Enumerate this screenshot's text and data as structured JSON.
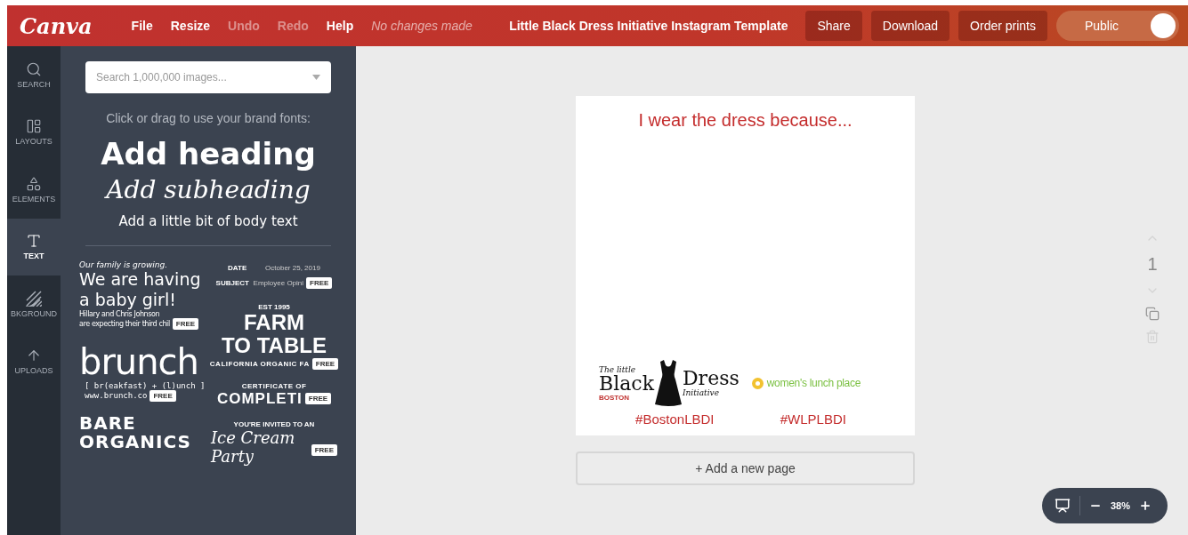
{
  "topbar": {
    "logo": "Canva",
    "menu": [
      {
        "label": "File",
        "disabled": false
      },
      {
        "label": "Resize",
        "disabled": false
      },
      {
        "label": "Undo",
        "disabled": true
      },
      {
        "label": "Redo",
        "disabled": true
      },
      {
        "label": "Help",
        "disabled": false
      }
    ],
    "status": "No changes made",
    "title": "Little Black Dress Initiative Instagram Template",
    "buttons": [
      "Share",
      "Download",
      "Order prints"
    ],
    "visibility": {
      "label": "Public",
      "on": true
    }
  },
  "rail": [
    {
      "label": "SEARCH",
      "selected": false
    },
    {
      "label": "LAYOUTS",
      "selected": false
    },
    {
      "label": "ELEMENTS",
      "selected": false
    },
    {
      "label": "TEXT",
      "selected": true
    },
    {
      "label": "BKGROUND",
      "selected": false
    },
    {
      "label": "UPLOADS",
      "selected": false
    }
  ],
  "panel": {
    "search": {
      "placeholder": "Search 1,000,000 images..."
    },
    "hint": "Click or drag to use your brand fonts:",
    "add_heading": "Add heading",
    "add_subheading": "Add subheading",
    "add_body": "Add a little bit of body text",
    "templates": [
      [
        {
          "badge": "FREE",
          "lines": [
            {
              "kind": "hand-small",
              "text": "Our family is growing."
            },
            {
              "kind": "hand-large",
              "text": "We are having"
            },
            {
              "kind": "hand-large",
              "text": "a baby girl!"
            },
            {
              "kind": "hand-tiny",
              "text": "Hillary and Chris Johnson"
            },
            {
              "kind": "hand-tiny",
              "text": "are expecting their third chil"
            }
          ]
        },
        {
          "badge": "FREE",
          "lines": [
            {
              "kind": "huge",
              "text": "brunch"
            },
            {
              "kind": "mono",
              "text": "[ br(eakfast) + (l)unch ]"
            },
            {
              "kind": "mono",
              "text": "www.brunch.co"
            }
          ]
        },
        {
          "lines": [
            {
              "kind": "wide",
              "text": "BARE"
            },
            {
              "kind": "wide",
              "text": "ORGANICS"
            }
          ]
        }
      ],
      [
        {
          "badge": "FREE",
          "lines": [
            {
              "kind": "pair",
              "label": "DATE",
              "value": "October 25, 2019"
            },
            {
              "kind": "pair",
              "label": "SUBJECT",
              "value": "Employee Opini"
            }
          ]
        },
        {
          "badge": "FREE",
          "lines": [
            {
              "kind": "tiny-caps",
              "text": "EST 1995"
            },
            {
              "kind": "bold-big",
              "text": "FARM"
            },
            {
              "kind": "bold-big",
              "text": "TO TABLE"
            },
            {
              "kind": "small-caps",
              "text": "CALIFORNIA ORGANIC FA"
            }
          ]
        },
        {
          "badge": "FREE",
          "lines": [
            {
              "kind": "small-caps",
              "text": "CERTIFICATE OF"
            },
            {
              "kind": "bold-mid",
              "text": "COMPLETI"
            }
          ]
        },
        {
          "badge": "FREE",
          "lines": [
            {
              "kind": "tiny-caps",
              "text": "YOU'RE INVITED TO AN"
            },
            {
              "kind": "script",
              "text": "Ice Cream Party"
            }
          ]
        }
      ]
    ]
  },
  "design": {
    "heading": "I wear the dress because...",
    "logo_left": {
      "top": "The little",
      "left": "Black",
      "right": "Dress",
      "bottom": "Initiative",
      "org": "BOSTON"
    },
    "logo_right": "women's lunch place",
    "hashtags": [
      "#BostonLBDI",
      "#WLPLBDI"
    ]
  },
  "add_page": "+ Add a new page",
  "page_number": "1",
  "zoom": "38%"
}
